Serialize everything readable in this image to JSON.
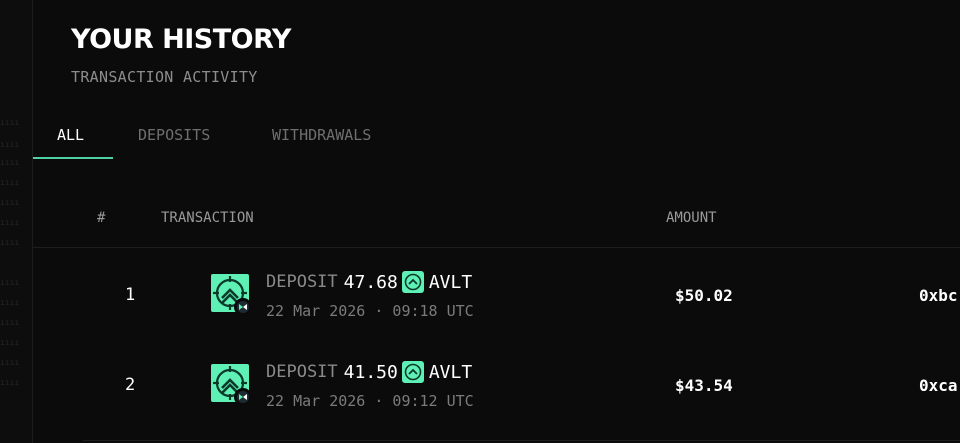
{
  "header": {
    "title": "YOUR HISTORY",
    "subtitle": "TRANSACTION ACTIVITY"
  },
  "tabs": [
    {
      "label": "ALL",
      "active": true
    },
    {
      "label": "DEPOSITS",
      "active": false
    },
    {
      "label": "WITHDRAWALS",
      "active": false
    }
  ],
  "table": {
    "columns": [
      "#",
      "TRANSACTION",
      "AMOUNT"
    ],
    "rows": [
      {
        "index": "1",
        "type": "DEPOSIT",
        "amount": "47.68",
        "token": "AVLT",
        "date": "22 Mar 2026 · 09:18 UTC",
        "usd": "$50.02",
        "address": "0xbc"
      },
      {
        "index": "2",
        "type": "DEPOSIT",
        "amount": "41.50",
        "token": "AVLT",
        "date": "22 Mar 2026 · 09:12 UTC",
        "usd": "$43.54",
        "address": "0xca"
      }
    ]
  },
  "colors": {
    "accent": "#4fd1a5",
    "token_green": "#5ef0b5",
    "background": "#0b0b0b"
  },
  "icons": {
    "token_icon": "avlt-token-icon",
    "vault_icon": "vault-deposit-icon"
  }
}
